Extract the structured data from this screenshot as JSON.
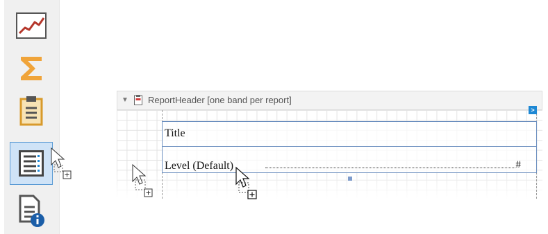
{
  "toolbox": {
    "tools": [
      {
        "icon": "line-chart-icon",
        "selected": false
      },
      {
        "icon": "summary-sigma-icon",
        "selected": false
      },
      {
        "icon": "clipboard-icon",
        "selected": false
      },
      {
        "icon": "table-of-contents-icon",
        "selected": true
      },
      {
        "icon": "report-info-icon",
        "selected": false
      }
    ]
  },
  "band": {
    "label": "ReportHeader [one band per report]",
    "smart_tag_glyph": ">"
  },
  "toc": {
    "title": "Title",
    "level": "Level (Default)",
    "page_number_placeholder": "#"
  },
  "colors": {
    "selection_fill": "#cfe3f7",
    "selection_border": "#5b9bd5",
    "accent_blue": "#1e88d4",
    "chart_red": "#b5372b",
    "sigma_orange": "#f0a43a",
    "toc_border": "#6c8fbf"
  }
}
